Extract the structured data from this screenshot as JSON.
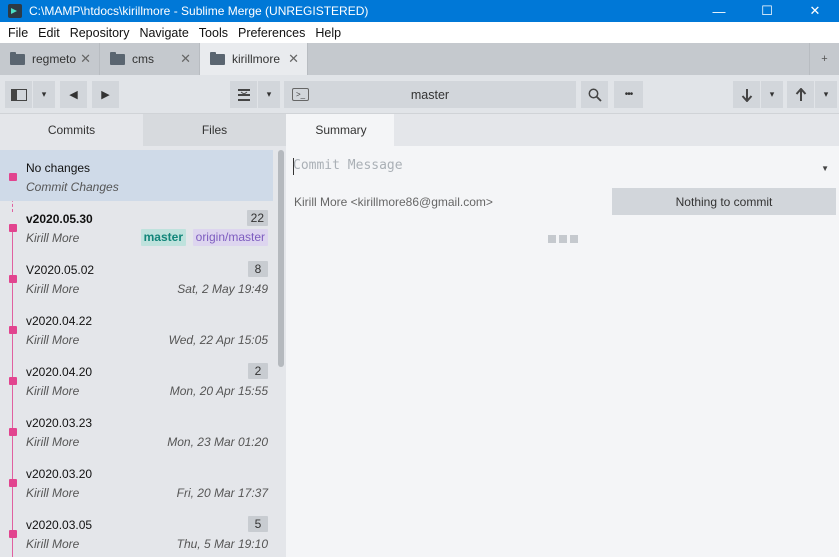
{
  "window": {
    "title": "C:\\MAMP\\htdocs\\kirillmore - Sublime Merge (UNREGISTERED)",
    "controls": [
      "—",
      "☐",
      "✕"
    ]
  },
  "menu": [
    "File",
    "Edit",
    "Repository",
    "Navigate",
    "Tools",
    "Preferences",
    "Help"
  ],
  "tabs": [
    {
      "label": "regmeto",
      "close": "✕"
    },
    {
      "label": "cms",
      "close": "✕"
    },
    {
      "label": "kirillmore",
      "close": "✕"
    }
  ],
  "toolbar": {
    "branch": "master",
    "toggle_icon": "sidebar-toggle-icon",
    "back_icon": "◀",
    "forward_icon": "▶",
    "stash_icon": "≚",
    "search_icon": "search-icon",
    "more_icon": "•••",
    "pull_icon": "🡓",
    "push_icon": "🡑",
    "dropdown": "▾",
    "add_tab": "+"
  },
  "left_tabs": {
    "commits": "Commits",
    "files": "Files"
  },
  "commits": [
    {
      "title": "No changes",
      "subtitle": "Commit Changes"
    },
    {
      "title": "v2020.05.30",
      "author": "Kirill More",
      "count": "22",
      "tags": [
        "master",
        "origin/master"
      ]
    },
    {
      "title": "V2020.05.02",
      "author": "Kirill More",
      "date": "Sat, 2 May 19:49",
      "count": "8"
    },
    {
      "title": "v2020.04.22",
      "author": "Kirill More",
      "date": "Wed, 22 Apr 15:05"
    },
    {
      "title": "v2020.04.20",
      "author": "Kirill More",
      "date": "Mon, 20 Apr 15:55",
      "count": "2"
    },
    {
      "title": "v2020.03.23",
      "author": "Kirill More",
      "date": "Mon, 23 Mar 01:20"
    },
    {
      "title": "v2020.03.20",
      "author": "Kirill More",
      "date": "Fri, 20 Mar 17:37"
    },
    {
      "title": "v2020.03.05",
      "author": "Kirill More",
      "date": "Thu, 5 Mar 19:10",
      "count": "5"
    }
  ],
  "summary": {
    "tab": "Summary",
    "placeholder": "Commit Message",
    "author": "Kirill More <kirillmore86@gmail.com>",
    "commit_button": "Nothing to commit"
  },
  "colors": {
    "graph": "#e2448f",
    "titlebar": "#0078d7"
  }
}
